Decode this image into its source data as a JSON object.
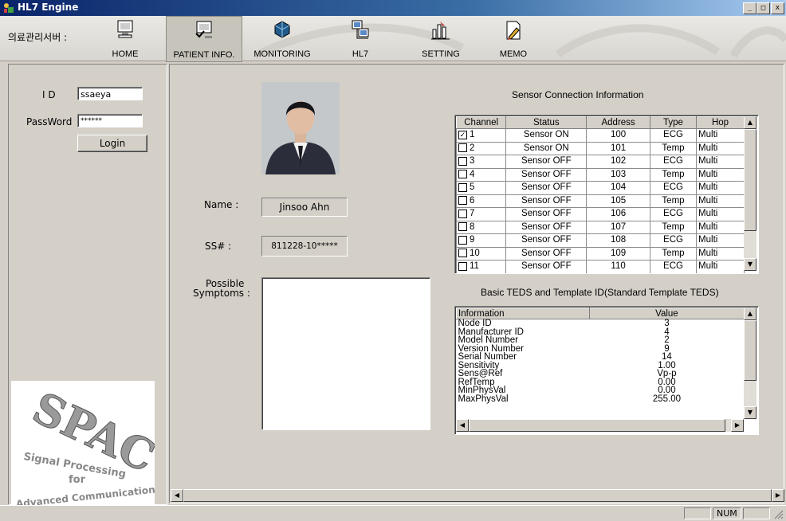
{
  "window": {
    "title": "HL7 Engine",
    "minimize": "_",
    "maximize": "□",
    "close": "x"
  },
  "toolbar": {
    "label": "의료관리서버 :",
    "buttons": [
      {
        "label": "HOME",
        "icon": "monitor-icon"
      },
      {
        "label": "PATIENT INFO.",
        "icon": "monitor-check-icon"
      },
      {
        "label": "MONITORING",
        "icon": "cube-icon"
      },
      {
        "label": "HL7",
        "icon": "network-computers-icon"
      },
      {
        "label": "SETTING",
        "icon": "chart-hand-icon"
      },
      {
        "label": "MEMO",
        "icon": "document-pen-icon"
      }
    ]
  },
  "login": {
    "id_label": "I D",
    "id_value": "ssaeya",
    "password_label": "PassWord",
    "password_value": "******",
    "login_button": "Login"
  },
  "logo": {
    "text_line1": "Signal Processing",
    "text_line2": "for",
    "text_line3": "Advanced Communications",
    "mark": "SPAC"
  },
  "patient": {
    "name_label": "Name :",
    "name_value": "Jinsoo Ahn",
    "ss_label": "SS# :",
    "ss_value": "811228-10*****",
    "symptoms_label_1": "Possible",
    "symptoms_label_2": "Symptoms :",
    "symptoms_value": ""
  },
  "sensor": {
    "title": "Sensor Connection Information",
    "columns": [
      "Channel",
      "Status",
      "Address",
      "Type",
      "Hop"
    ],
    "rows": [
      {
        "channel": "1",
        "checked": true,
        "status": "Sensor ON",
        "address": "100",
        "type": "ECG",
        "hop": "Multi"
      },
      {
        "channel": "2",
        "checked": false,
        "status": "Sensor ON",
        "address": "101",
        "type": "Temp",
        "hop": "Multi"
      },
      {
        "channel": "3",
        "checked": false,
        "status": "Sensor OFF",
        "address": "102",
        "type": "ECG",
        "hop": "Multi"
      },
      {
        "channel": "4",
        "checked": false,
        "status": "Sensor OFF",
        "address": "103",
        "type": "Temp",
        "hop": "Multi"
      },
      {
        "channel": "5",
        "checked": false,
        "status": "Sensor OFF",
        "address": "104",
        "type": "ECG",
        "hop": "Multi"
      },
      {
        "channel": "6",
        "checked": false,
        "status": "Sensor OFF",
        "address": "105",
        "type": "Temp",
        "hop": "Multi"
      },
      {
        "channel": "7",
        "checked": false,
        "status": "Sensor OFF",
        "address": "106",
        "type": "ECG",
        "hop": "Multi"
      },
      {
        "channel": "8",
        "checked": false,
        "status": "Sensor OFF",
        "address": "107",
        "type": "Temp",
        "hop": "Multi"
      },
      {
        "channel": "9",
        "checked": false,
        "status": "Sensor OFF",
        "address": "108",
        "type": "ECG",
        "hop": "Multi"
      },
      {
        "channel": "10",
        "checked": false,
        "status": "Sensor OFF",
        "address": "109",
        "type": "Temp",
        "hop": "Multi"
      },
      {
        "channel": "11",
        "checked": false,
        "status": "Sensor OFF",
        "address": "110",
        "type": "ECG",
        "hop": "Multi"
      }
    ]
  },
  "teds": {
    "title": "Basic TEDS and Template ID(Standard Template TEDS)",
    "columns": [
      "Information",
      "Value"
    ],
    "rows": [
      {
        "info": "Node ID",
        "value": "3"
      },
      {
        "info": "Manufacturer ID",
        "value": "4"
      },
      {
        "info": "Model Number",
        "value": "2"
      },
      {
        "info": "Version Number",
        "value": "9"
      },
      {
        "info": "Serial Number",
        "value": "14"
      },
      {
        "info": "Sensitivity",
        "value": "1.00"
      },
      {
        "info": "Sens@Ref",
        "value": "Vp-p"
      },
      {
        "info": "RefTemp",
        "value": "0.00"
      },
      {
        "info": "MinPhysVal",
        "value": "0.00"
      },
      {
        "info": "MaxPhysVal",
        "value": "255.00"
      }
    ]
  },
  "statusbar": {
    "pane1": "",
    "num": "NUM",
    "pane3": ""
  }
}
